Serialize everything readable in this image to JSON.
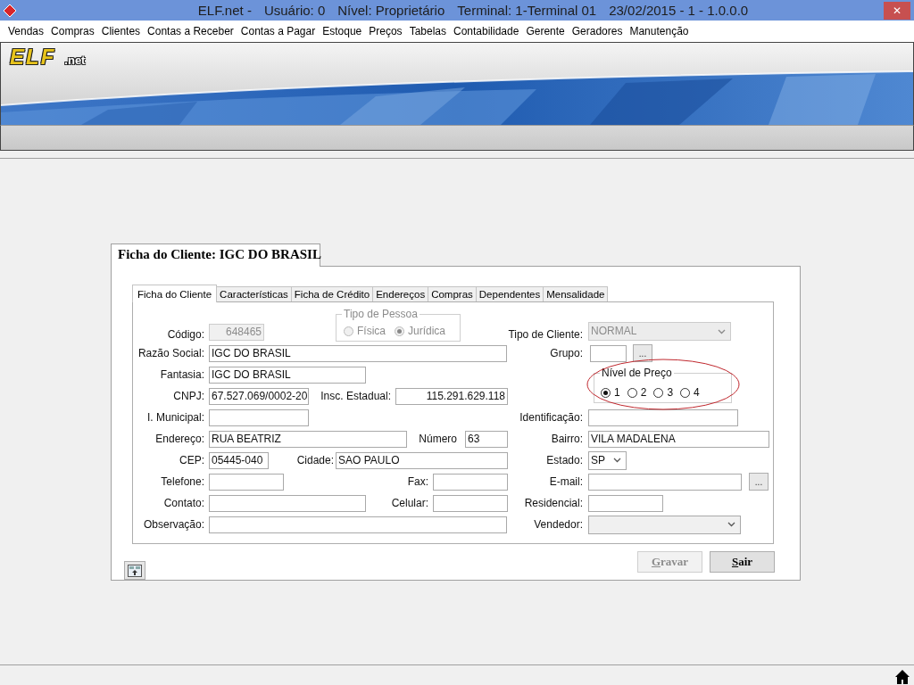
{
  "window": {
    "title_parts": [
      "ELF.net -",
      "Usuário: 0",
      "Nível: Proprietário",
      "Terminal: 1-Terminal 01",
      "23/02/2015 - 1 - 1.0.0.0"
    ],
    "close_glyph": "✕"
  },
  "menu": [
    "Vendas",
    "Compras",
    "Clientes",
    "Contas a Receber",
    "Contas a Pagar",
    "Estoque",
    "Preços",
    "Tabelas",
    "Contabilidade",
    "Gerente",
    "Geradores",
    "Manutenção"
  ],
  "logo": {
    "name": "ELF",
    "suffix": ".net"
  },
  "dialog": {
    "title": "Ficha do Cliente: IGC DO BRASIL",
    "tabs": [
      {
        "label": "Ficha do Cliente",
        "selected": true
      },
      {
        "label": "Características",
        "selected": false
      },
      {
        "label": "Ficha de Crédito",
        "selected": false
      },
      {
        "label": "Endereços",
        "selected": false
      },
      {
        "label": "Compras",
        "selected": false
      },
      {
        "label": "Dependentes",
        "selected": false
      },
      {
        "label": "Mensalidade",
        "selected": false
      }
    ],
    "form": {
      "codigo": {
        "label": "Código:",
        "value": "648465",
        "disabled": true
      },
      "tipo_de_pessoa": {
        "title": "Tipo de Pessoa",
        "disabled": true,
        "options": [
          {
            "label": "Física",
            "selected": false
          },
          {
            "label": "Jurídica",
            "selected": true
          }
        ]
      },
      "tipo_de_cliente": {
        "label": "Tipo de Cliente:",
        "value": "NORMAL",
        "disabled": true
      },
      "razao_social": {
        "label": "Razão Social:",
        "value": "IGC DO BRASIL"
      },
      "grupo": {
        "label": "Grupo:",
        "button": "..."
      },
      "fantasia": {
        "label": "Fantasia:",
        "value": "IGC DO BRASIL"
      },
      "nivel_de_preco": {
        "title": "Nível de Preço",
        "highlighted": true,
        "options": [
          {
            "label": "1",
            "selected": true
          },
          {
            "label": "2",
            "selected": false
          },
          {
            "label": "3",
            "selected": false
          },
          {
            "label": "4",
            "selected": false
          }
        ]
      },
      "cnpj": {
        "label": "CNPJ:",
        "value": "67.527.069/0002-20"
      },
      "insc_estadual": {
        "label": "Insc. Estadual:",
        "value": "115.291.629.118"
      },
      "i_municipal": {
        "label": "I. Municipal:"
      },
      "identificacao": {
        "label": "Identificação:"
      },
      "endereco": {
        "label": "Endereço:",
        "value": "RUA BEATRIZ"
      },
      "numero": {
        "label": "Número",
        "value": "63"
      },
      "bairro": {
        "label": "Bairro:",
        "value": "VILA MADALENA"
      },
      "cep": {
        "label": "CEP:",
        "value": "05445-040"
      },
      "cidade": {
        "label": "Cidade:",
        "value": "SAO PAULO"
      },
      "estado": {
        "label": "Estado:",
        "value": "SP"
      },
      "telefone": {
        "label": "Telefone:"
      },
      "fax": {
        "label": "Fax:"
      },
      "email": {
        "label": "E-mail:",
        "button": "..."
      },
      "contato": {
        "label": "Contato:"
      },
      "celular": {
        "label": "Celular:"
      },
      "residencial": {
        "label": "Residencial:"
      },
      "observacao": {
        "label": "Observação:"
      },
      "vendedor": {
        "label": "Vendedor:"
      }
    },
    "buttons": [
      {
        "label": "Gravar",
        "disabled": true
      },
      {
        "label": "Sair",
        "disabled": false
      }
    ]
  }
}
